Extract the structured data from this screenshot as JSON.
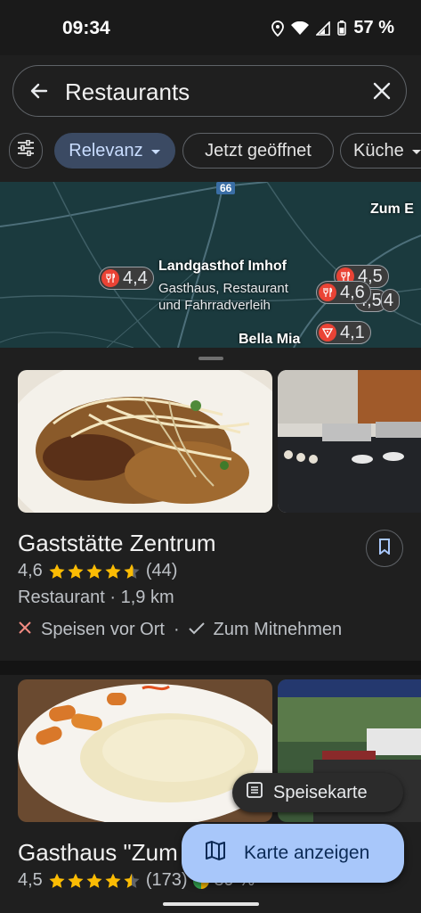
{
  "status_bar": {
    "time": "09:34",
    "battery": "57 %"
  },
  "search": {
    "query": "Restaurants"
  },
  "chips": {
    "relevance": "Relevanz",
    "open_now": "Jetzt geöffnet",
    "cuisine": "Küche"
  },
  "map": {
    "road_number": "66",
    "place_label_1": "Landgasthof Imhof",
    "place_sub_1a": "Gasthaus, Restaurant",
    "place_sub_1b": "und Fahrradverleih",
    "place_label_2": "Bella Mia",
    "place_label_3": "Zum E",
    "pins": [
      "4,4",
      "4,5",
      "4,6",
      "4,5",
      "4",
      "4,1"
    ]
  },
  "results": [
    {
      "name": "Gaststätte Zentrum",
      "rating": "4,6",
      "rating_value": 4.6,
      "reviews": "(44)",
      "category": "Restaurant · 1,9 km",
      "dine_in": "Speisen vor Ort",
      "takeaway": "Zum Mitnehmen",
      "separator": "·"
    },
    {
      "name": "Gasthaus \"Zum",
      "rating": "4,5",
      "rating_value": 4.5,
      "reviews": "(173)",
      "extra": "89 %"
    }
  ],
  "buttons": {
    "menu": "Speisekarte",
    "show_map": "Karte anzeigen"
  },
  "colors": {
    "star": "#fbbc04",
    "accent_fab": "#a8c7fa",
    "chip_selected": "#3b4a63",
    "pin_red": "#ea4335"
  }
}
